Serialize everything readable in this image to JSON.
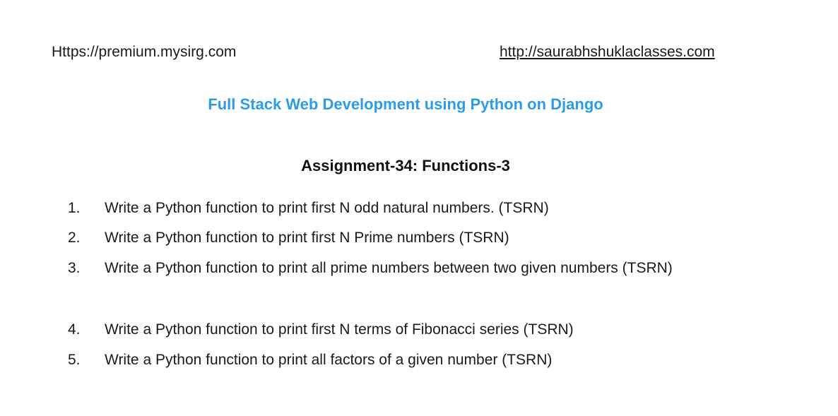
{
  "header": {
    "left_url": "Https://premium.mysirg.com",
    "right_url": "http://saurabhshuklaclasses.com"
  },
  "course_title": "Full Stack Web Development using Python on Django",
  "assignment_title": "Assignment-34: Functions-3",
  "tasks": [
    {
      "num": "1.",
      "text": "Write a Python function to print first N odd natural numbers. (TSRN)"
    },
    {
      "num": "2.",
      "text": "Write a Python function to print first N Prime numbers (TSRN)"
    },
    {
      "num": "3.",
      "text": "Write a Python function to print all prime numbers between two given numbers (TSRN)"
    },
    {
      "num": "4.",
      "text": "Write a Python function to print first N terms of Fibonacci series (TSRN)"
    },
    {
      "num": "5.",
      "text": "Write a Python function to print all factors of a given number (TSRN)"
    }
  ]
}
